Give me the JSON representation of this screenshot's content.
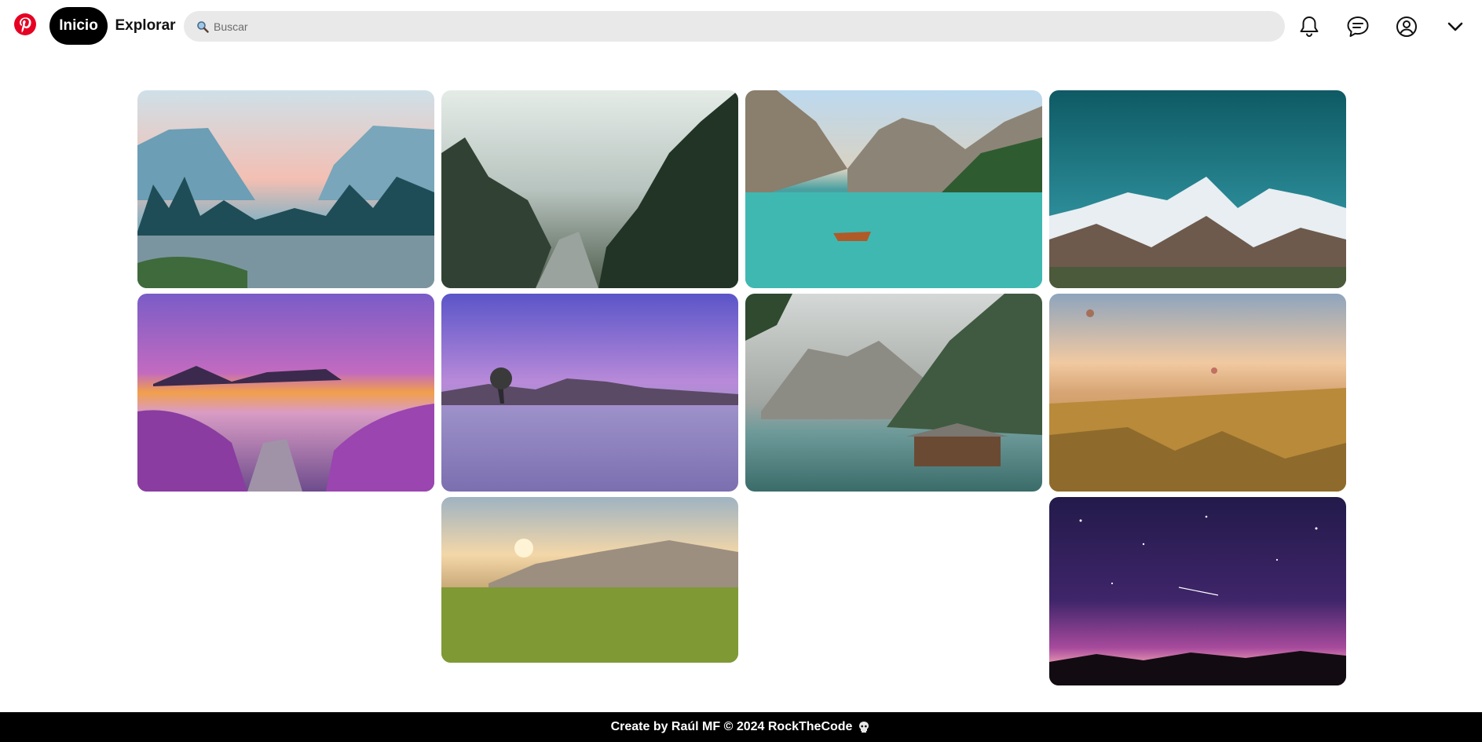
{
  "header": {
    "logo_icon": "pinterest-logo-icon",
    "nav": {
      "home_label": "Inicio",
      "explore_label": "Explorar"
    },
    "search": {
      "placeholder": "Buscar",
      "value": "",
      "icon": "search-icon"
    },
    "icons": [
      "bell-icon",
      "chat-icon",
      "user-circle-icon",
      "chevron-down-icon"
    ],
    "accent_color": "#e60023"
  },
  "pins": [
    {
      "subject": "valley-river-at-dawn"
    },
    {
      "subject": "misty-forest-creek"
    },
    {
      "subject": "turquoise-mountain-lake-with-boat"
    },
    {
      "subject": "snowy-mountains-under-teal-sky"
    },
    {
      "subject": "purple-flower-lake-sunset"
    },
    {
      "subject": "lone-tree-in-purple-lake"
    },
    {
      "subject": "mountain-lake-with-boathouse"
    },
    {
      "subject": "hot-air-balloons-over-canyon"
    },
    {
      "subject": "meadow-mountain-sunrise"
    },
    {
      "subject": "milky-way-night-sky"
    }
  ],
  "footer": {
    "text": "Create by Raúl MF © 2024 RockTheCode",
    "emoji_icon": "skull-icon"
  }
}
